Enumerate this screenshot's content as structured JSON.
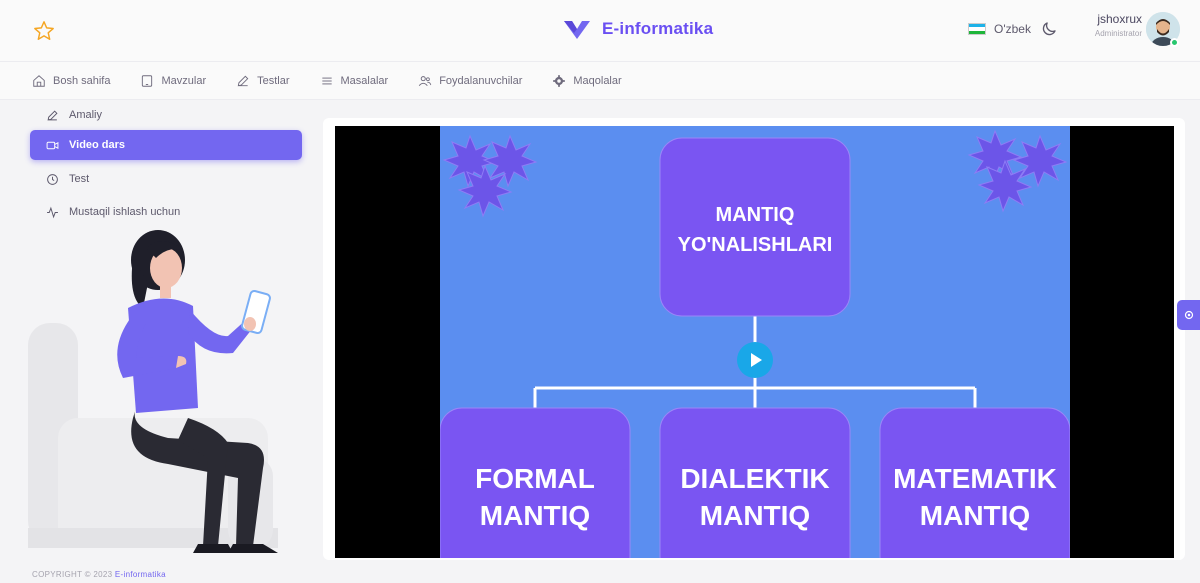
{
  "header": {
    "brand_name": "E-informatika",
    "language": "O'zbek",
    "user_name": "jshoxrux",
    "user_role": "Administrator"
  },
  "menu": [
    {
      "label": "Bosh sahifa",
      "icon": "home-icon"
    },
    {
      "label": "Mavzular",
      "icon": "tablet-icon"
    },
    {
      "label": "Testlar",
      "icon": "pencil-icon"
    },
    {
      "label": "Masalalar",
      "icon": "list-icon"
    },
    {
      "label": "Foydalanuvchilar",
      "icon": "users-icon"
    },
    {
      "label": "Maqolalar",
      "icon": "settings-icon"
    }
  ],
  "sidebar": {
    "items": [
      {
        "label": "Amaliy",
        "icon": "pencil-icon"
      },
      {
        "label": "Video dars",
        "icon": "video-icon",
        "active": true
      },
      {
        "label": "Test",
        "icon": "clock-icon"
      },
      {
        "label": "Mustaqil ishlash uchun",
        "icon": "activity-icon"
      }
    ]
  },
  "video": {
    "slide_top_line1": "MANTIQ",
    "slide_top_line2": "YO'NALISHLARI",
    "boxes": [
      {
        "line1": "FORMAL",
        "line2": "MANTIQ"
      },
      {
        "line1": "DIALEKTIK",
        "line2": "MANTIQ"
      },
      {
        "line1": "MATEMATIK",
        "line2": "MANTIQ"
      }
    ]
  },
  "footer": {
    "copyright": "COPYRIGHT © 2023",
    "link": "E-informatika"
  },
  "colors": {
    "accent": "#7367f0",
    "brand": "#6a4ff2",
    "slide_bg": "#5b8ef0",
    "slide_box": "#7a55f2",
    "play": "#19a7e8"
  }
}
